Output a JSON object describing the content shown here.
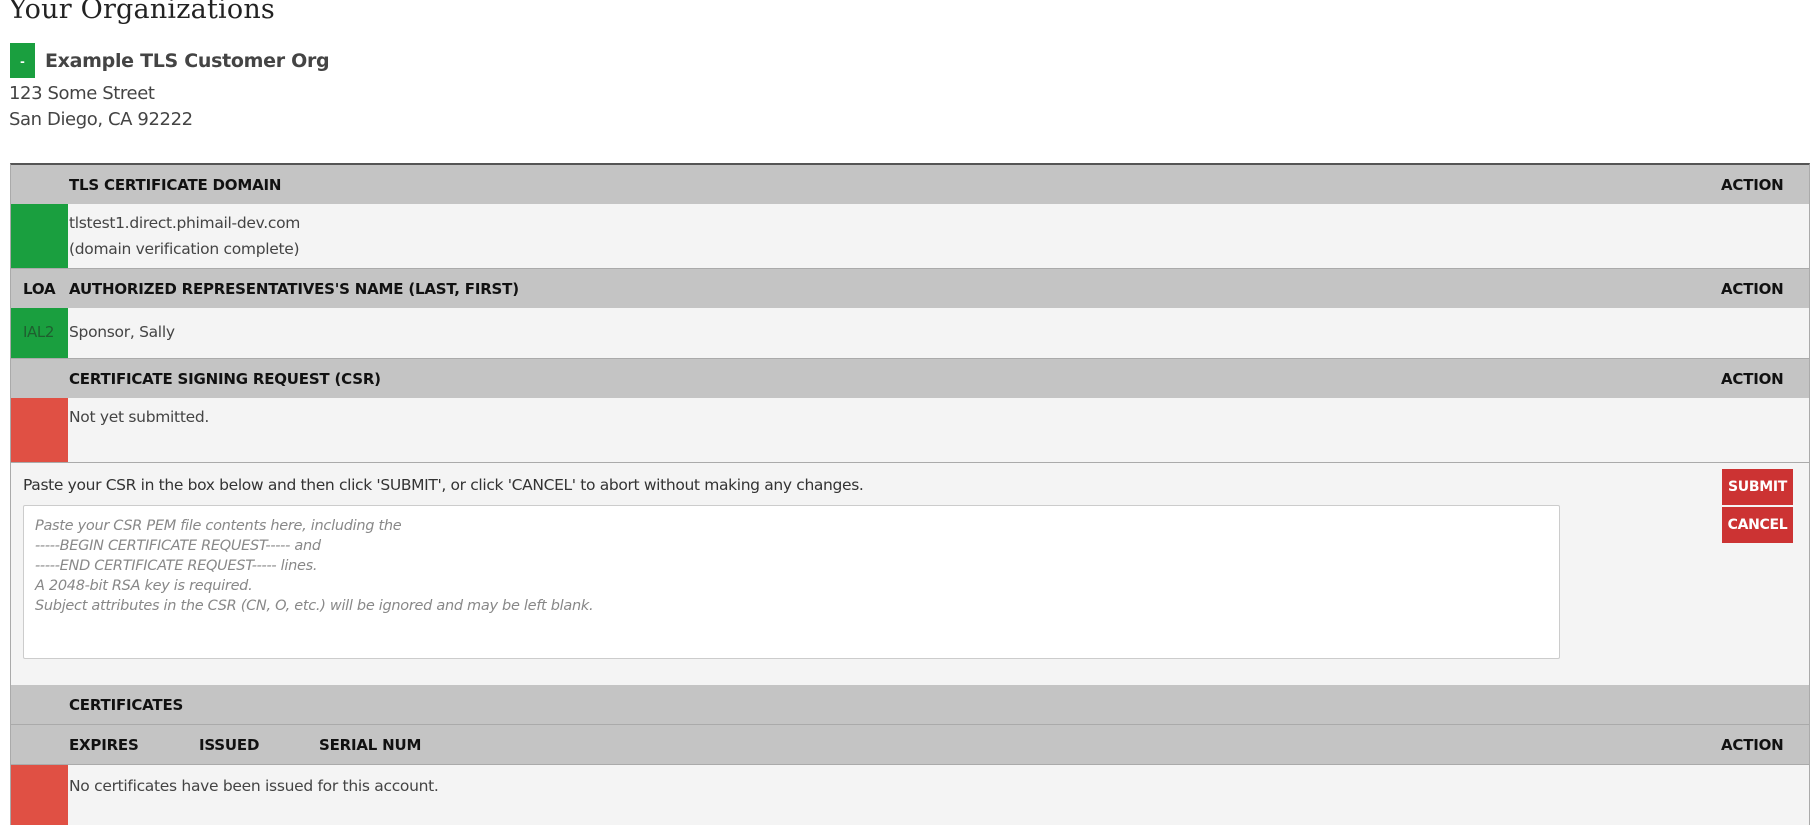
{
  "page": {
    "title": "Your Organizations"
  },
  "organization": {
    "toggle_label": "-",
    "name": "Example TLS Customer Org",
    "address_line1": "123 Some Street",
    "address_line2": "San Diego, CA 92222"
  },
  "colors": {
    "ok": "#1a9f3f",
    "error": "#e05044",
    "button": "#cc3333",
    "header_bg": "#c4c4c4"
  },
  "domain_section": {
    "header": "TLS CERTIFICATE DOMAIN",
    "action_header": "ACTION",
    "status": "ok",
    "domain": "tlstest1.direct.phimail-dev.com",
    "note": "(domain verification complete)"
  },
  "rep_section": {
    "loa_header": "LOA",
    "header": "AUTHORIZED REPRESENTATIVES'S NAME (LAST, FIRST)",
    "action_header": "ACTION",
    "rows": [
      {
        "loa": "IAL2",
        "name": "Sponsor, Sally",
        "status": "ok"
      }
    ]
  },
  "csr_section": {
    "header": "CERTIFICATE SIGNING REQUEST (CSR)",
    "action_header": "ACTION",
    "status": "error",
    "status_text": "Not yet submitted.",
    "instructions": "Paste your CSR in the box below and then click 'SUBMIT', or click 'CANCEL' to abort without making any changes.",
    "input_value": "",
    "input_placeholder": "Paste your CSR PEM file contents here, including the\n-----BEGIN CERTIFICATE REQUEST----- and\n-----END CERTIFICATE REQUEST----- lines.\nA 2048-bit RSA key is required.\nSubject attributes in the CSR (CN, O, etc.) will be ignored and may be left blank.",
    "submit_label": "SUBMIT",
    "cancel_label": "CANCEL"
  },
  "certificates_section": {
    "header": "CERTIFICATES",
    "columns": [
      "EXPIRES",
      "ISSUED",
      "SERIAL NUM"
    ],
    "action_header": "ACTION",
    "status": "error",
    "empty_text": "No certificates have been issued for this account."
  }
}
